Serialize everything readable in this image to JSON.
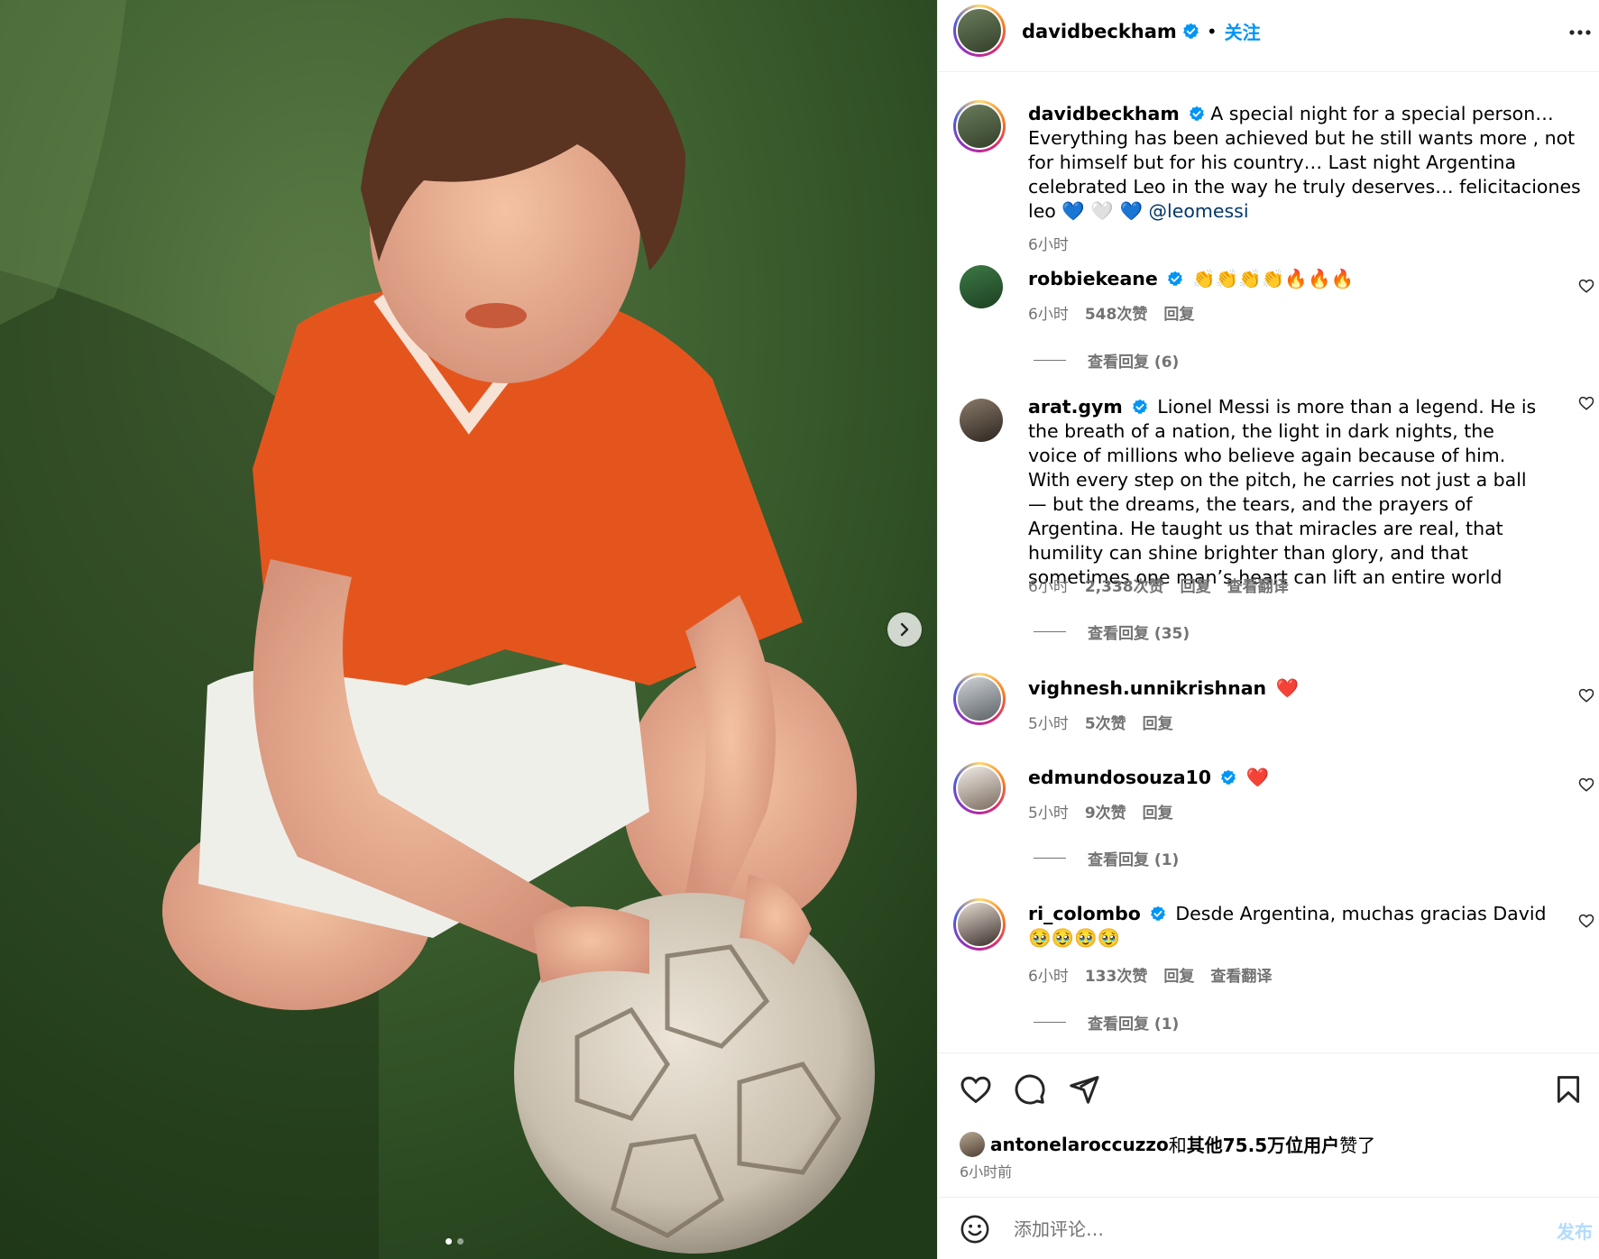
{
  "theme": {
    "accent": "#0095f6",
    "muted": "#737373",
    "heart_red": "#ff3040",
    "border": "#efefef"
  },
  "post": {
    "author": "davidbeckham",
    "separator": "•",
    "follow_label": "关注",
    "more_icon": "more-horizontal-icon",
    "caption": {
      "text": "A special night for a special person… Everything has been achieved but he still wants more , not for himself but for his country… Last night Argentina celebrated Leo in the way he truly deserves… felicitaciones leo",
      "emojis": "💙 🤍 💙",
      "mention": "@leomessi",
      "time": "6小时"
    },
    "media": {
      "next_icon": "chevron-right-icon",
      "slide_count": 2,
      "active_slide": 1
    }
  },
  "comments": [
    {
      "username": "robbiekeane",
      "verified": true,
      "text": "",
      "emojis": "👏👏👏👏🔥🔥🔥",
      "time": "6小时",
      "likes": "548次赞",
      "reply": "回复",
      "translate": "",
      "view_replies": "查看回复 (6)"
    },
    {
      "username": "arat.gym",
      "verified": true,
      "text": "Lionel Messi is more than a legend. He is the breath of a nation, the light in dark nights, the voice of millions who believe again because of him. With every step on the pitch, he carries not just a ball — but the dreams, the tears, and the prayers of Argentina. He taught us that miracles are real, that humility can shine brighter than glory, and that sometimes one man’s heart can lift an entire world",
      "emojis": "",
      "time": "6小时",
      "likes": "2,338次赞",
      "reply": "回复",
      "translate": "查看翻译",
      "view_replies": "查看回复 (35)"
    },
    {
      "username": "vighnesh.unnikrishnan",
      "verified": false,
      "text": "",
      "emojis": "❤️",
      "time": "5小时",
      "likes": "5次赞",
      "reply": "回复",
      "translate": "",
      "view_replies": ""
    },
    {
      "username": "edmundosouza10",
      "verified": true,
      "text": "",
      "emojis": "❤️",
      "time": "5小时",
      "likes": "9次赞",
      "reply": "回复",
      "translate": "",
      "view_replies": "查看回复 (1)"
    },
    {
      "username": "ri_colombo",
      "verified": true,
      "text": "Desde Argentina, muchas gracias David",
      "emojis": "🥹🥹🥹🥹",
      "time": "6小时",
      "likes": "133次赞",
      "reply": "回复",
      "translate": "查看翻译",
      "view_replies": "查看回复 (1)"
    }
  ],
  "actions": {
    "like_icon": "heart-icon",
    "comment_icon": "comment-bubble-icon",
    "share_icon": "send-icon",
    "save_icon": "bookmark-icon"
  },
  "likes_summary": {
    "first_user": "antonelaroccuzzo",
    "joiner": "和",
    "others": "其他75.5万位用户",
    "suffix": "赞了",
    "time_ago": "6小时前"
  },
  "add_comment": {
    "emoji_icon": "smiley-icon",
    "placeholder": "添加评论…",
    "post_label": "发布"
  }
}
